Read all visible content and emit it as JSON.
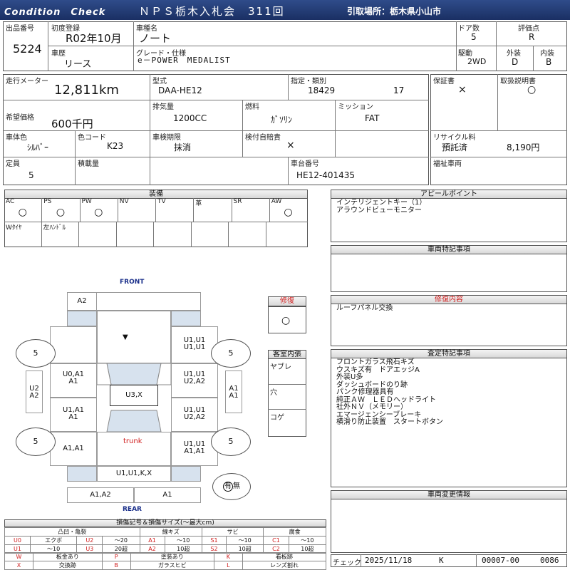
{
  "header": {
    "condition_check": "Condition　Check",
    "title": "ＮＰＳ栃木入札会　311回",
    "pickup": "引取場所：栃木県小山市"
  },
  "vehicle": {
    "lot_label": "出品番号",
    "lot": "5224",
    "first_reg_label": "初度登録",
    "first_reg": "R02年10月",
    "name_label": "車種名",
    "name": "ノート",
    "doors_label": "ドア数",
    "doors": "5",
    "rating_label": "評価点",
    "rating": "R",
    "history_label": "車歴",
    "history": "リース",
    "grade_label": "グレード・仕様",
    "grade": "e－POWER　MEDALIST",
    "drive_label": "駆動",
    "drive": "2WD",
    "exterior_label": "外装",
    "exterior": "D",
    "interior_label": "内装",
    "interior": "B",
    "mileage_label": "走行メーター",
    "mileage": "12,811km",
    "model_label": "型式",
    "model": "DAA-HE12",
    "designation_label": "指定・類別",
    "designation": "18429",
    "category": "17",
    "warranty_label": "保証書",
    "warranty": "×",
    "manual_label": "取扱説明書",
    "manual": "○",
    "price_label": "希望価格",
    "price": "600千円",
    "displacement_label": "排気量",
    "displacement": "1200CC",
    "fuel_label": "燃料",
    "fuel": "ｶﾞｿﾘﾝ",
    "mission_label": "ミッション",
    "mission": "FAT",
    "color_label": "車体色",
    "color": "ｼﾙﾊﾞｰ",
    "color_code_label": "色コード",
    "color_code": "K23",
    "inspection_label": "車検期限",
    "inspection": "抹消",
    "liability_label": "検付自賠責",
    "liability": "×",
    "recycle_label": "リサイクル料",
    "recycle_status": "預託済",
    "recycle_fee": "8,190円",
    "capacity_label": "定員",
    "capacity": "5",
    "load_label": "積載量",
    "chassis_label": "車台番号",
    "chassis": "HE12-401435",
    "welfare_label": "福祉車両"
  },
  "equipment": {
    "title": "装備",
    "row1": [
      {
        "label": "AC",
        "mark": "○"
      },
      {
        "label": "PS",
        "mark": "○"
      },
      {
        "label": "PW",
        "mark": "○"
      },
      {
        "label": "NV",
        "mark": ""
      },
      {
        "label": "TV",
        "mark": ""
      },
      {
        "label": "革",
        "mark": ""
      },
      {
        "label": "SR",
        "mark": ""
      },
      {
        "label": "AW",
        "mark": "○"
      }
    ],
    "row2": [
      {
        "label": "Wﾀｲﾔ"
      },
      {
        "label": "左ﾊﾝﾄﾞﾙ"
      },
      {
        "label": ""
      },
      {
        "label": ""
      },
      {
        "label": ""
      },
      {
        "label": ""
      },
      {
        "label": ""
      }
    ]
  },
  "diagram": {
    "front": "FRONT",
    "rear": "REAR",
    "trunk": "trunk",
    "panels": {
      "a2_top": "A2",
      "hood": "▼",
      "front_left": "",
      "front_right": "U1,U1\nU1,U1",
      "fl_door": "U0,A1\nA1",
      "fr_door": "U1,U1\nU2,A2",
      "roof": "U3,X",
      "rl_door": "U1,A1\nA1",
      "rr_door": "U1,U1\nU2,A2",
      "rear_left": "A1,A1",
      "rear_right": "U1,U1\nA1,A1",
      "left_side": "U2\nA2",
      "right_side": "A1\nA1",
      "rear_bumper": "U1,U1,K,X",
      "rear_low_left": "A1,A2",
      "rear_low_right": "A1"
    },
    "wheels": {
      "fl": "5",
      "fr": "5",
      "rl": "5",
      "rr": "5"
    },
    "spare_mark": "有",
    "spare_none": "無"
  },
  "repair": {
    "title": "修復",
    "value": "○"
  },
  "cabin": {
    "title": "客室内張",
    "items": [
      "ヤブレ",
      "穴",
      "コゲ"
    ]
  },
  "appeal": {
    "title": "アピールポイント",
    "text": "インテリジェントキー（1）\nアラウンドビューモニター"
  },
  "special": {
    "title": "車両特記事項"
  },
  "repair_content": {
    "title": "修復内容",
    "text": "ルーフパネル交換"
  },
  "inspection_notes": {
    "title": "査定特記事項",
    "text": "フロントガラス飛石キズ\nウスキズ有　ドアエッジA\n外装U多\nダッシュボードのり跡\nパンク修理器具有\n純正ＡＷ　ＬＥＤヘッドライト\n社外ＮＶ（メモリー）\nエマージェンシーブレーキ\n横滑り防止装置　スタートボタン"
  },
  "change_info": {
    "title": "車両変更情報"
  },
  "legend": {
    "title": "損傷記号＆損傷サイズ(～最大cm)",
    "group1": "凸凹・亀裂",
    "group2": "線キズ",
    "group3": "サビ",
    "group4": "腐食",
    "rows": [
      [
        "U0",
        "エクボ",
        "U2",
        "～20",
        "A1",
        "～10",
        "S1",
        "～10",
        "C1",
        "～10"
      ],
      [
        "U1",
        "～10",
        "U3",
        "20超",
        "A2",
        "10超",
        "S2",
        "10超",
        "C2",
        "10超"
      ]
    ],
    "codes": [
      [
        "W",
        "板金あり",
        "P",
        "塗装あり",
        "K",
        "看板跡"
      ],
      [
        "X",
        "交換跡",
        "B",
        "ガラスヒビ",
        "L",
        "レンズ割れ"
      ]
    ]
  },
  "footer": {
    "check_label": "チェック",
    "check_date": "2025/11/18",
    "checker": "K",
    "code1": "00007-00",
    "code2": "0086"
  }
}
